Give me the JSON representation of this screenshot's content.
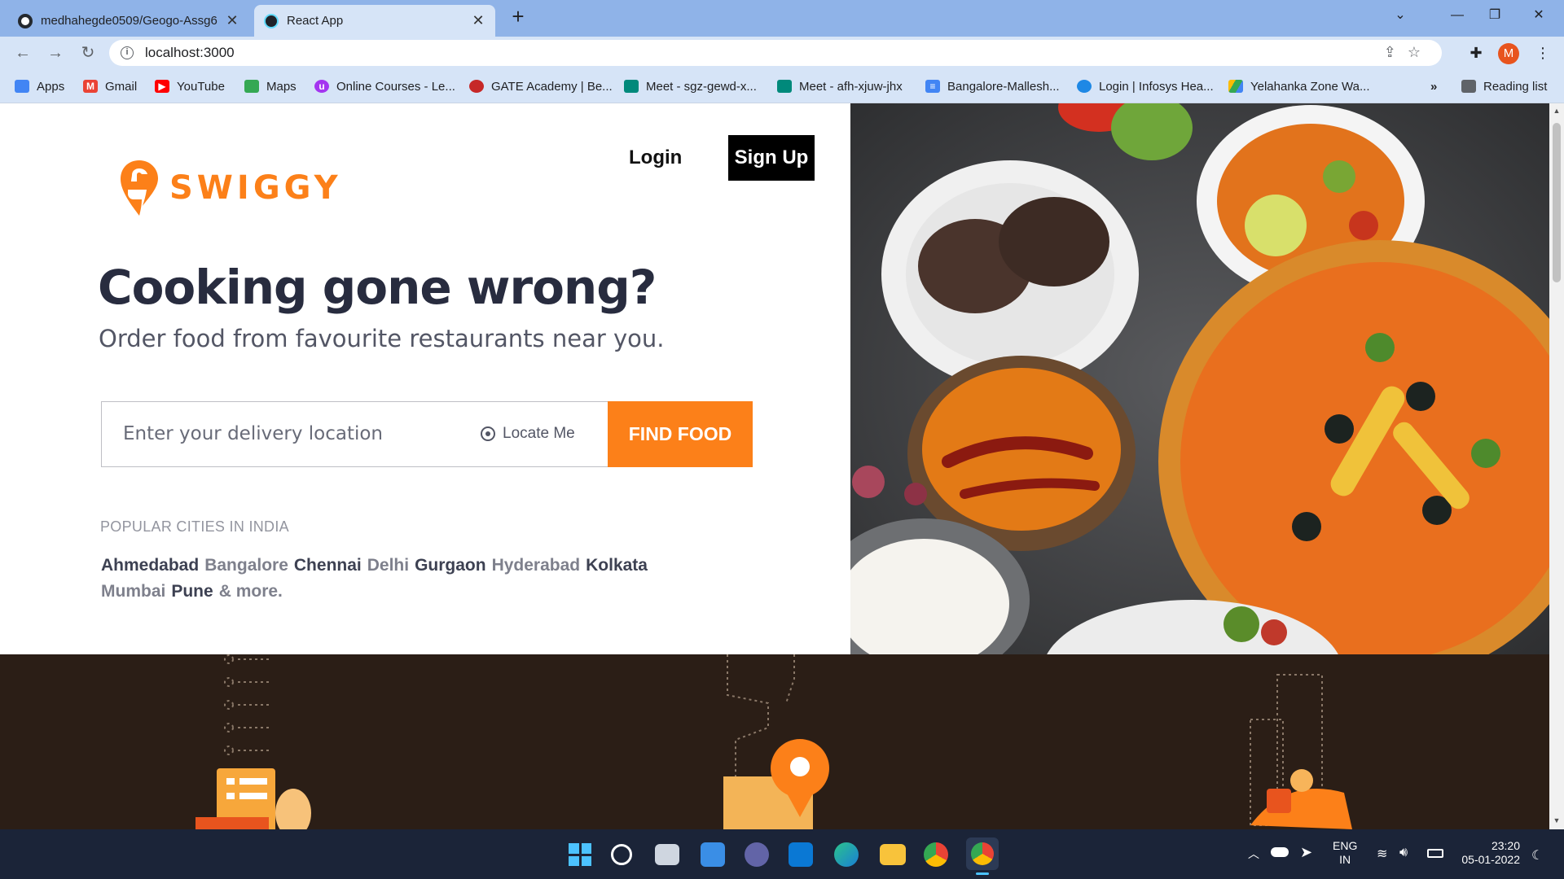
{
  "browser": {
    "tabs": [
      {
        "title": "medhahegde0509/Geogo-Assg6",
        "active": false
      },
      {
        "title": "React App",
        "active": true
      }
    ],
    "url": "localhost:3000",
    "profile_initial": "M",
    "bookmarks": [
      {
        "label": "Apps",
        "icon": "apps-grid-icon"
      },
      {
        "label": "Gmail",
        "icon": "gmail-icon"
      },
      {
        "label": "YouTube",
        "icon": "youtube-icon"
      },
      {
        "label": "Maps",
        "icon": "maps-icon"
      },
      {
        "label": "Online Courses - Le...",
        "icon": "udemy-icon"
      },
      {
        "label": "GATE Academy | Be...",
        "icon": "gate-icon"
      },
      {
        "label": "Meet - sgz-gewd-x...",
        "icon": "meet-icon"
      },
      {
        "label": "Meet - afh-xjuw-jhx",
        "icon": "meet-icon"
      },
      {
        "label": "Bangalore-Mallesh...",
        "icon": "docs-icon"
      },
      {
        "label": "Login | Infosys Hea...",
        "icon": "infosys-icon"
      },
      {
        "label": "Yelahanka Zone Wa...",
        "icon": "drive-icon"
      }
    ],
    "overflow": "»",
    "reading_list": "Reading list"
  },
  "page": {
    "brand": "SWIGGY",
    "login_label": "Login",
    "signup_label": "Sign Up",
    "headline": "Cooking gone wrong?",
    "subheadline": "Order food from favourite restaurants near you.",
    "search_placeholder": "Enter your delivery location",
    "locate_label": "Locate Me",
    "find_food_label": "FIND FOOD",
    "popular_heading": "POPULAR CITIES IN INDIA",
    "cities": [
      "Ahmedabad",
      "Bangalore",
      "Chennai",
      "Delhi",
      "Gurgaon",
      "Hyderabad",
      "Kolkata",
      "Mumbai",
      "Pune",
      "& more."
    ],
    "accent_color": "#fc8019"
  },
  "taskbar": {
    "language_line1": "ENG",
    "language_line2": "IN",
    "time": "23:20",
    "date": "05-01-2022"
  }
}
